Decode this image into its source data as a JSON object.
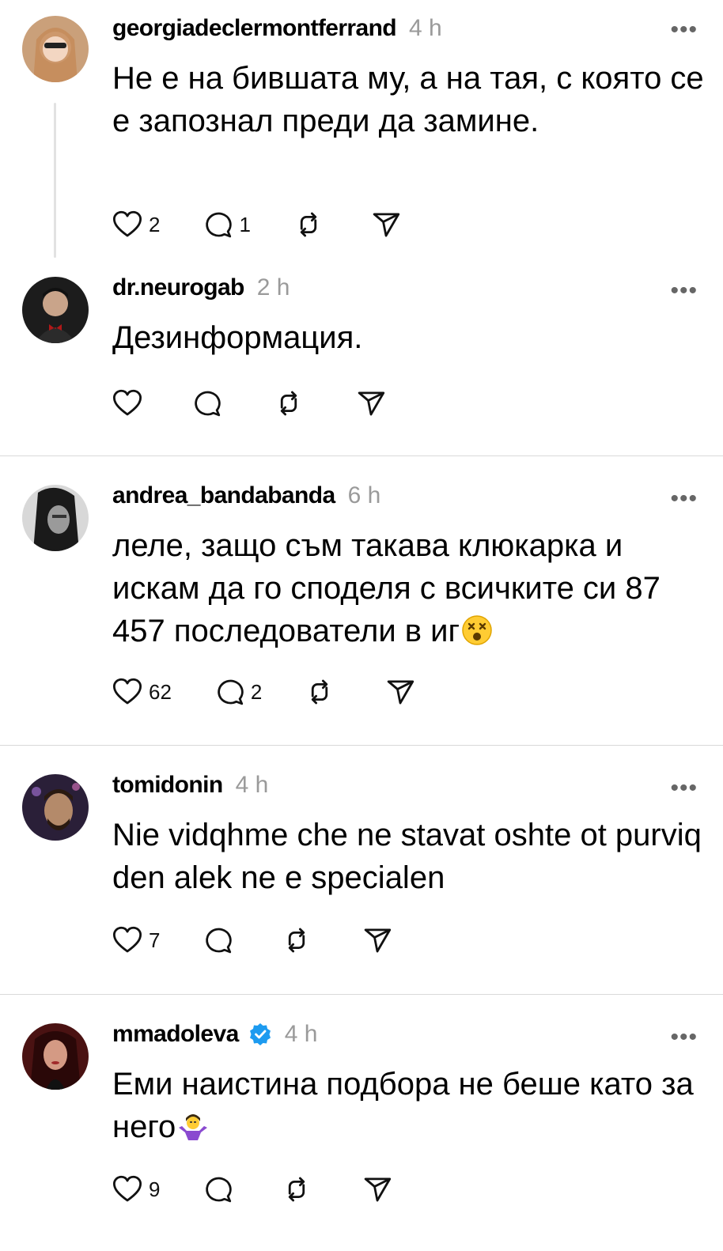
{
  "posts": [
    {
      "username": "georgiadeclermontferrand",
      "time": "4 h",
      "text": "Не е на бившата му, а на тая, с която се е запознал преди да замине.",
      "likes": "2",
      "replies": "1",
      "verified": false,
      "avatar_colors": [
        "#d8b08c",
        "#7a4a2a"
      ]
    },
    {
      "username": "dr.neurogab",
      "time": "2 h",
      "text": "Дезинформация.",
      "likes": "",
      "replies": "",
      "verified": false,
      "avatar_colors": [
        "#2a2a2a",
        "#c9a48a"
      ]
    },
    {
      "username": "andrea_bandabanda",
      "time": "6 h",
      "text": "леле, защо съм такава клюкарка и искам да го споделя с всичките си 87 457 последователи в иг",
      "emoji": "dizzy-face-emoji",
      "likes": "62",
      "replies": "2",
      "verified": false,
      "avatar_colors": [
        "#e8e8e8",
        "#3a3a3a"
      ]
    },
    {
      "username": "tomidonin",
      "time": "4 h",
      "text": "Nie vidqhme che ne stavat oshte ot purviq den alek ne e specialen",
      "likes": "7",
      "replies": "",
      "verified": false,
      "avatar_colors": [
        "#3a2a4a",
        "#b48a6a"
      ]
    },
    {
      "username": "mmadoleva",
      "time": "4 h",
      "text": "Еми наистина подбора не беше като за него",
      "emoji": "person-shrugging-emoji",
      "likes": "9",
      "replies": "",
      "verified": true,
      "avatar_colors": [
        "#5a1a1a",
        "#d49a84"
      ]
    }
  ],
  "more_label": "•••",
  "accent": "#1d9bf0"
}
